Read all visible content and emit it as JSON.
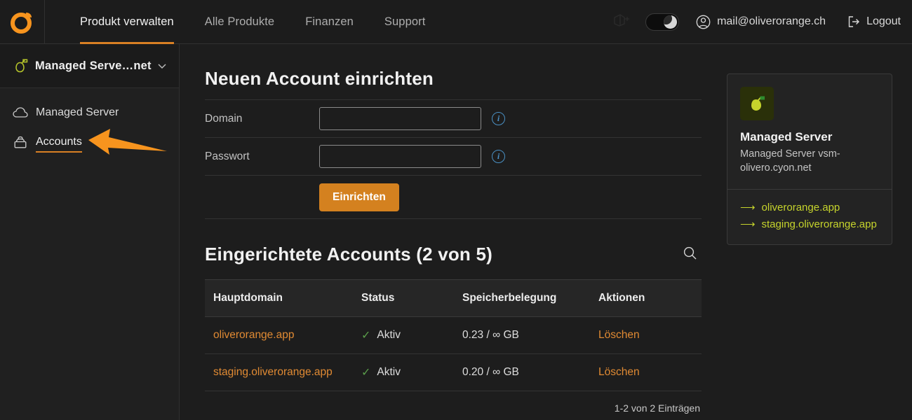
{
  "brand": {
    "logo_name": "cyon-logo",
    "accent": "#d98024",
    "pear_green": "#c6d42c"
  },
  "topnav": {
    "items": [
      {
        "label": "Produkt verwalten",
        "active": true
      },
      {
        "label": "Alle Produkte",
        "active": false
      },
      {
        "label": "Finanzen",
        "active": false
      },
      {
        "label": "Support",
        "active": false
      }
    ],
    "theme_toggle": {
      "name": "dark-mode-toggle",
      "state": "on",
      "icon": "moon-icon"
    },
    "user_email": "mail@oliverorange.ch",
    "logout_label": "Logout"
  },
  "sidebar": {
    "product_title": "Managed Serve…net",
    "items": [
      {
        "label": "Managed Server",
        "icon": "cloud-icon",
        "active": false
      },
      {
        "label": "Accounts",
        "icon": "archive-box-icon",
        "active": true
      }
    ]
  },
  "form": {
    "heading": "Neuen Account einrichten",
    "fields": [
      {
        "label": "Domain",
        "value": "",
        "placeholder": ""
      },
      {
        "label": "Passwort",
        "value": "",
        "placeholder": ""
      }
    ],
    "submit_label": "Einrichten"
  },
  "accounts_table": {
    "heading": "Eingerichtete Accounts (2 von 5)",
    "search_icon": "search-icon",
    "columns": [
      "Hauptdomain",
      "Status",
      "Speicherbelegung",
      "Aktionen"
    ],
    "rows": [
      {
        "domain": "oliverorange.app",
        "status": "Aktiv",
        "storage": "0.23 / ∞ GB",
        "action": "Löschen"
      },
      {
        "domain": "staging.oliverorange.app",
        "status": "Aktiv",
        "storage": "0.20 / ∞ GB",
        "action": "Löschen"
      }
    ],
    "footer": "1-2 von 2 Einträgen"
  },
  "info_card": {
    "icon": "pear-icon",
    "title": "Managed Server",
    "subtitle": "Managed Server vsm-olivero.cyon.net",
    "links": [
      {
        "label": "oliverorange.app"
      },
      {
        "label": "staging.oliverorange.app"
      }
    ]
  }
}
